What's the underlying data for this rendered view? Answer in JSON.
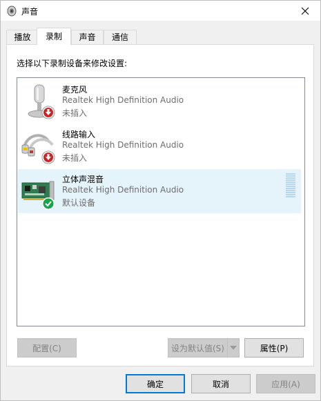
{
  "window": {
    "title": "声音",
    "icon": "speaker-icon"
  },
  "tabs": [
    {
      "label": "播放"
    },
    {
      "label": "录制"
    },
    {
      "label": "声音"
    },
    {
      "label": "通信"
    }
  ],
  "active_tab": "录制",
  "instruction": "选择以下录制设备来修改设置:",
  "devices": [
    {
      "name": "麦克风",
      "driver": "Realtek High Definition Audio",
      "status": "未插入",
      "icon": "microphone-icon",
      "badge": "unplugged-arrow-icon"
    },
    {
      "name": "线路输入",
      "driver": "Realtek High Definition Audio",
      "status": "未插入",
      "icon": "line-in-cable-icon",
      "badge": "unplugged-arrow-icon"
    },
    {
      "name": "立体声混音",
      "driver": "Realtek High Definition Audio",
      "status": "默认设备",
      "icon": "sound-card-icon",
      "badge": "default-check-icon",
      "selected": true
    }
  ],
  "buttons": {
    "configure": "配置(C)",
    "set_default": "设为默认值(S)",
    "properties": "属性(P)",
    "ok": "确定",
    "cancel": "取消",
    "apply": "应用(A)"
  },
  "colors": {
    "selection": "#e5f3fb",
    "default_badge": "#16a34a",
    "unplugged_badge": "#c62828",
    "focus_border": "#0078d7"
  }
}
